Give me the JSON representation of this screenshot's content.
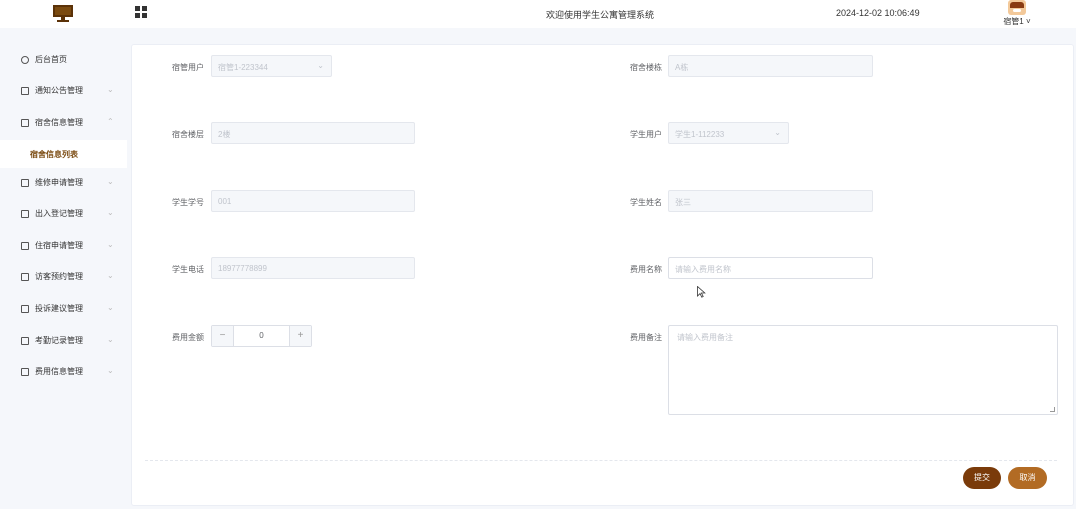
{
  "header": {
    "logo_icon": "computer-monitor-icon",
    "menu_toggle_icon": "grid-icon",
    "welcome": "欢迎使用学生公寓管理系统",
    "datetime": "2024-12-02 10:06:49",
    "user_name": "宿管1",
    "avatar_icon": "avatar-image",
    "accent_color": "#7a4a10"
  },
  "sidebar": {
    "items": [
      {
        "label": "后台首页",
        "icon": "clock-icon"
      },
      {
        "label": "通知公告管理",
        "icon": "doc-icon",
        "arrow": "⌄"
      },
      {
        "label": "宿舍信息管理",
        "icon": "doc-icon",
        "arrow": "⌃"
      },
      {
        "label": "维修申请管理",
        "icon": "doc-icon",
        "arrow": "⌄"
      },
      {
        "label": "出入登记管理",
        "icon": "doc-icon",
        "arrow": "⌄"
      },
      {
        "label": "住宿申请管理",
        "icon": "doc-icon",
        "arrow": "⌄"
      },
      {
        "label": "访客预约管理",
        "icon": "doc-icon",
        "arrow": "⌄"
      },
      {
        "label": "投诉建议管理",
        "icon": "doc-icon",
        "arrow": "⌄"
      },
      {
        "label": "考勤记录管理",
        "icon": "doc-icon",
        "arrow": "⌄"
      },
      {
        "label": "费用信息管理",
        "icon": "doc-icon",
        "arrow": "⌄"
      }
    ],
    "active_submenu": "宿舍信息列表"
  },
  "form": {
    "dorm_user_label": "宿管用户",
    "dorm_user_value": "宿管1-223344",
    "building_label": "宿舍楼栋",
    "building_value": "A栋",
    "floor_label": "宿舍楼层",
    "floor_value": "2楼",
    "student_user_label": "学生用户",
    "student_user_value": "学生1-112233",
    "student_no_label": "学生学号",
    "student_no_value": "001",
    "student_name_label": "学生姓名",
    "student_name_value": "张三",
    "phone_label": "学生电话",
    "phone_value": "18977778899",
    "fee_name_label": "费用名称",
    "fee_name_placeholder": "请输入费用名称",
    "fee_amount_label": "费用金额",
    "fee_amount_value": "0",
    "fee_note_label": "费用备注",
    "fee_note_placeholder": "请输入费用备注",
    "minus": "−",
    "plus": "+",
    "select_arrow": "⌄"
  },
  "actions": {
    "submit": "提交",
    "cancel": "取消",
    "submit_color": "#7a3b0a",
    "cancel_color": "#b26b24"
  }
}
